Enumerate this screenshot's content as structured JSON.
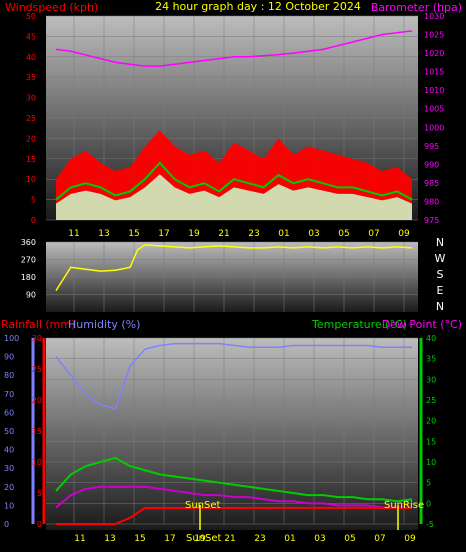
{
  "chart_data": [
    {
      "type": "line",
      "title": "24 hour graph day : 12 October 2024",
      "left_axis_label": "Windspeed (kph)",
      "right_axis_label": "Barometer (hpa)",
      "left_ylim": [
        0,
        50
      ],
      "left_ticks": [
        "0",
        "5",
        "10",
        "15",
        "20",
        "25",
        "30",
        "35",
        "40",
        "45",
        "50"
      ],
      "right_ylim": [
        975,
        1030
      ],
      "right_ticks": [
        "975",
        "980",
        "985",
        "990",
        "995",
        "1000",
        "1005",
        "1010",
        "1015",
        "1020",
        "1025",
        "1030"
      ],
      "x_tick_labels": [
        "11",
        "13",
        "15",
        "17",
        "19",
        "21",
        "23",
        "01",
        "03",
        "05",
        "07",
        "09"
      ],
      "colors": {
        "gust": "#ff0000",
        "avg": "#00cc00",
        "wind": "#ccffcc",
        "baro": "#ff00ff"
      },
      "x_hours": [
        0,
        1,
        2,
        3,
        4,
        5,
        6,
        7,
        8,
        9,
        10,
        11,
        12,
        13,
        14,
        15,
        16,
        17,
        18,
        19,
        20,
        21,
        22,
        23,
        24
      ],
      "barometer": [
        1021,
        1020.5,
        1019.5,
        1018.5,
        1017.5,
        1017,
        1016.5,
        1016.5,
        1017,
        1017.5,
        1018,
        1018.5,
        1019,
        1019,
        1019.3,
        1019.6,
        1020,
        1020.5,
        1021,
        1022,
        1023,
        1024,
        1025,
        1025.5,
        1026
      ],
      "gust": [
        10,
        15,
        17,
        14,
        12,
        13,
        18,
        22,
        18,
        16,
        17,
        14,
        19,
        17,
        15,
        20,
        16,
        18,
        17,
        16,
        15,
        14,
        12,
        13,
        10
      ],
      "avg_wind": [
        5,
        8,
        9,
        8,
        6,
        7,
        10,
        14,
        10,
        8,
        9,
        7,
        10,
        9,
        8,
        11,
        9,
        10,
        9,
        8,
        8,
        7,
        6,
        7,
        5
      ]
    },
    {
      "type": "line",
      "right_labels": [
        "N",
        "W",
        "S",
        "E",
        "N"
      ],
      "left_ticks": [
        "90",
        "180",
        "270",
        "360"
      ],
      "ylim": [
        0,
        360
      ],
      "color": "#ffff00",
      "x_hours": [
        0,
        1,
        2,
        3,
        4,
        5,
        5.5,
        6,
        7,
        8,
        9,
        10,
        11,
        12,
        13,
        14,
        15,
        16,
        17,
        18,
        19,
        20,
        21,
        22,
        23,
        24
      ],
      "direction": [
        110,
        230,
        220,
        210,
        215,
        230,
        320,
        345,
        340,
        335,
        330,
        335,
        340,
        335,
        330,
        330,
        335,
        330,
        335,
        330,
        335,
        330,
        335,
        330,
        335,
        330
      ]
    },
    {
      "type": "line",
      "labels": {
        "rain": "Rainfall (mm)",
        "humidity": "Humidity (%)",
        "temp": "Temperature (°C)",
        "dew": "Dew Point (°C)"
      },
      "rain_ticks": [
        "0",
        "5",
        "10",
        "15",
        "20",
        "25",
        "30"
      ],
      "humidity_ticks": [
        "0",
        "10",
        "20",
        "30",
        "40",
        "50",
        "60",
        "70",
        "80",
        "90",
        "100"
      ],
      "temp_ticks": [
        "-5",
        "0",
        "5",
        "10",
        "15",
        "20",
        "25",
        "30",
        "35",
        "40"
      ],
      "temp_ylim": [
        -5,
        40
      ],
      "x_tick_labels": [
        "11",
        "13",
        "15",
        "17",
        "19",
        "21",
        "23",
        "01",
        "03",
        "05",
        "07",
        "09"
      ],
      "sunset_label": "SunSet",
      "sunrise_label": "SunRise",
      "colors": {
        "humidity": "#8080ff",
        "temp": "#00cc00",
        "dew": "#cc00cc",
        "rain": "#ff0000",
        "sun": "#ffff00"
      },
      "x_hours": [
        0,
        1,
        2,
        3,
        4,
        5,
        6,
        7,
        8,
        9,
        10,
        11,
        12,
        13,
        14,
        15,
        16,
        17,
        18,
        19,
        20,
        21,
        22,
        23,
        24
      ],
      "humidity": [
        90,
        80,
        70,
        64,
        62,
        85,
        94,
        96,
        97,
        97,
        97,
        97,
        96,
        95,
        95,
        95,
        96,
        96,
        96,
        96,
        96,
        96,
        95,
        95,
        95
      ],
      "temperature": [
        3,
        7,
        9,
        10,
        11,
        9,
        8,
        7,
        6.5,
        6,
        5.5,
        5,
        4.5,
        4,
        3.5,
        3,
        2.5,
        2,
        2,
        1.5,
        1.5,
        1,
        1,
        0.5,
        1
      ],
      "dewpoint": [
        -1,
        2,
        3.5,
        4,
        4,
        4,
        4,
        3.5,
        3,
        2.5,
        2,
        2,
        1.5,
        1.5,
        1,
        0.5,
        0.5,
        0,
        0,
        -0.5,
        -0.5,
        -0.5,
        -1,
        -1,
        -1
      ],
      "rain_total": [
        0,
        0,
        0,
        0,
        0,
        1,
        2.6,
        2.6,
        2.6,
        2.6,
        2.6,
        2.6,
        2.6,
        2.6,
        2.6,
        2.6,
        2.6,
        2.6,
        2.6,
        2.6,
        2.6,
        2.6,
        2.6,
        2.6,
        2.6
      ]
    }
  ]
}
